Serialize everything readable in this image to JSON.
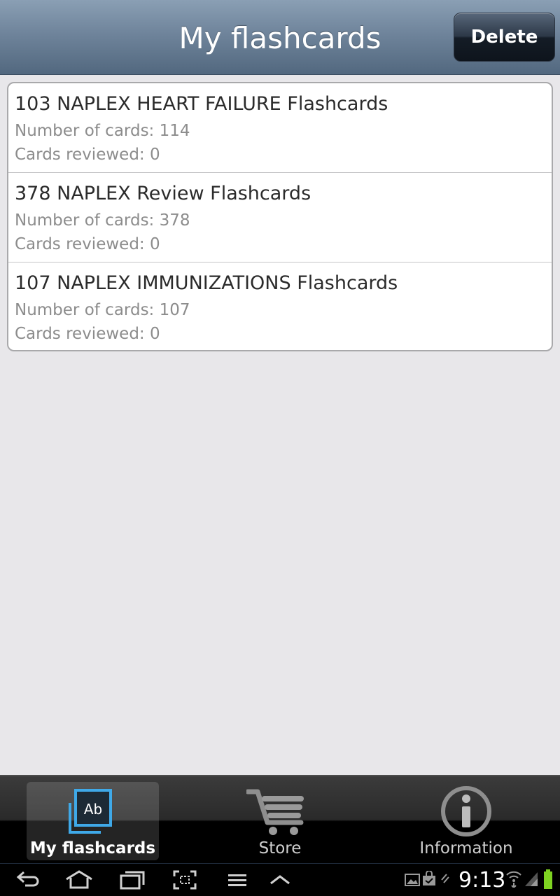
{
  "header": {
    "title": "My flashcards",
    "delete_label": "Delete"
  },
  "decks": [
    {
      "title": "103 NAPLEX HEART FAILURE Flashcards",
      "cards": "Number of cards: 114",
      "reviewed": "Cards reviewed: 0"
    },
    {
      "title": "378 NAPLEX Review Flashcards",
      "cards": "Number of cards: 378",
      "reviewed": "Cards reviewed: 0"
    },
    {
      "title": "107 NAPLEX IMMUNIZATIONS Flashcards",
      "cards": "Number of cards: 107",
      "reviewed": "Cards reviewed: 0"
    }
  ],
  "tabs": [
    {
      "label": "My flashcards",
      "icon": "flashcards-icon",
      "active": true
    },
    {
      "label": "Store",
      "icon": "cart-icon",
      "active": false
    },
    {
      "label": "Information",
      "icon": "info-icon",
      "active": false
    }
  ],
  "status": {
    "time": "9:13",
    "icons": [
      "gallery-icon",
      "shopping-bag-icon",
      "usb-icon",
      "wifi-icon",
      "signal-icon",
      "battery-icon"
    ]
  },
  "navigation": {
    "icons": [
      "back-icon",
      "home-icon",
      "recent-apps-icon",
      "screenshot-icon",
      "menu-icon",
      "chevron-up-icon"
    ]
  },
  "colors": {
    "header": "#6f849b",
    "accent_blue": "#3fa9e8",
    "battery": "#7ed321"
  }
}
